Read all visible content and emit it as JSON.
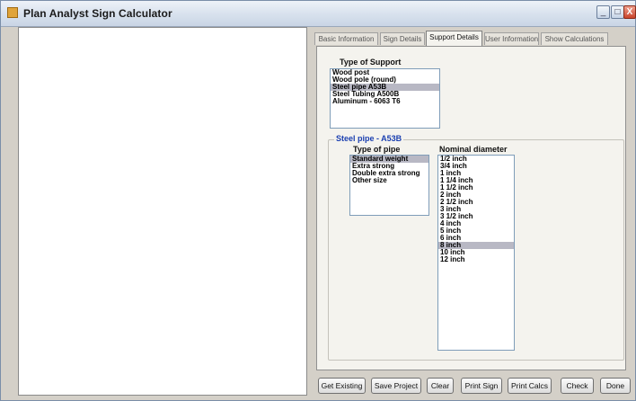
{
  "window": {
    "title": "Plan Analyst Sign Calculator",
    "controls": {
      "minimize": "_",
      "maximize": "□",
      "close": "X"
    }
  },
  "tabs": [
    {
      "label": "Basic Information"
    },
    {
      "label": "Sign Details"
    },
    {
      "label": "Support Details"
    },
    {
      "label": "User Information"
    },
    {
      "label": "Show Calculations"
    }
  ],
  "support": {
    "type_label": "Type of Support",
    "types": [
      "Wood post",
      "Wood pole (round)",
      "Steel pipe A53B",
      "Steel Tubing A500B",
      "Aluminum - 6063 T6"
    ],
    "selected_type_index": 2
  },
  "pipe_group": {
    "title": "Steel pipe - A53B",
    "pipe_type_label": "Type of pipe",
    "pipe_types": [
      "Standard weight",
      "Extra strong",
      "Double extra strong",
      "Other size"
    ],
    "selected_pipe_type_index": 0,
    "diameter_label": "Nominal diameter",
    "diameters": [
      "1/2 inch",
      "3/4 inch",
      "1 inch",
      "1 1/4 inch",
      "1 1/2 inch",
      "2 inch",
      "2 1/2 inch",
      "3 inch",
      "3 1/2 inch",
      "4 inch",
      "5 inch",
      "6 inch",
      "8 inch",
      "10 inch",
      "12 inch"
    ],
    "selected_diameter_index": 12
  },
  "buttons": {
    "get_existing": "Get Existing",
    "save_project": "Save Project",
    "clear": "Clear",
    "print_sign": "Print Sign",
    "print_calcs": "Print Calcs",
    "check": "Check",
    "done": "Done"
  },
  "colors": {
    "selection": "#b8b8c4",
    "group_title": "#1a3fb0",
    "accent": "#e0a43a"
  }
}
